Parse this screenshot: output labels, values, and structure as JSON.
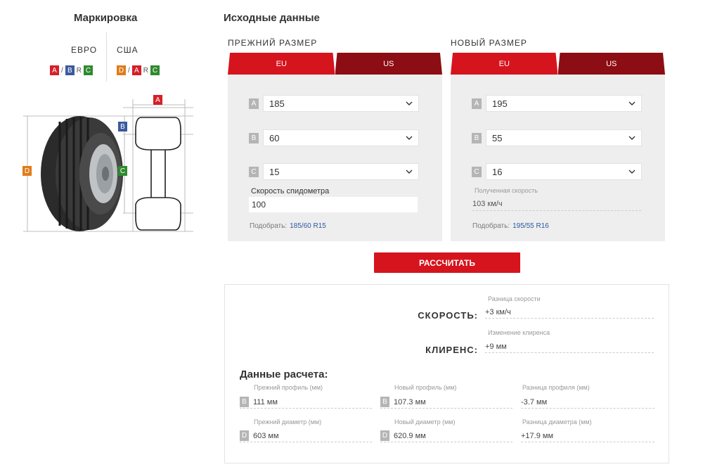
{
  "marking": {
    "title": "Маркировка",
    "euro_label": "ЕВРО",
    "usa_label": "США",
    "euro_badges": [
      "A",
      "/",
      "B",
      "R",
      "C"
    ],
    "usa_badges": [
      "D",
      "/",
      "A",
      "R",
      "C"
    ],
    "diagram_letters": {
      "a": "A",
      "b": "B",
      "c": "C",
      "d": "D"
    }
  },
  "source": {
    "title": "Исходные данные",
    "old": {
      "label": "ПРЕЖНИЙ РАЗМЕР",
      "tab_eu": "EU",
      "tab_us": "US",
      "fields": [
        {
          "letter": "A",
          "value": "185"
        },
        {
          "letter": "B",
          "value": "60"
        },
        {
          "letter": "C",
          "value": "15"
        }
      ],
      "speedo_label": "Скорость спидометра",
      "speedo_value": "100",
      "pick_label": "Подобрать:",
      "pick_link": "185/60 R15"
    },
    "new": {
      "label": "НОВЫЙ РАЗМЕР",
      "tab_eu": "EU",
      "tab_us": "US",
      "fields": [
        {
          "letter": "A",
          "value": "195"
        },
        {
          "letter": "B",
          "value": "55"
        },
        {
          "letter": "C",
          "value": "16"
        }
      ],
      "speed_label": "Полученная скорость",
      "speed_value": "103 км/ч",
      "pick_label": "Подобрать:",
      "pick_link": "195/55 R16"
    },
    "calc_button": "РАССЧИТАТЬ"
  },
  "results": {
    "speed_caption": "Разница скорости",
    "speed_key": "СКОРОСТЬ:",
    "speed_value": "+3 км/ч",
    "clearance_caption": "Изменение клиренса",
    "clearance_key": "КЛИРЕНС:",
    "clearance_value": "+9 мм",
    "calc_title": "Данные расчета:",
    "rows": [
      {
        "cells": [
          {
            "caption": "Прежний профиль (мм)",
            "letter": "B",
            "value": "111 мм"
          },
          {
            "caption": "Новый профиль (мм)",
            "letter": "B",
            "value": "107.3 мм"
          },
          {
            "caption": "Разница профиля (мм)",
            "letter": "",
            "value": "-3.7 мм"
          }
        ]
      },
      {
        "cells": [
          {
            "caption": "Прежний диаметр (мм)",
            "letter": "D",
            "value": "603 мм"
          },
          {
            "caption": "Новый диаметр (мм)",
            "letter": "D",
            "value": "620.9 мм"
          },
          {
            "caption": "Разница диаметра (мм)",
            "letter": "",
            "value": "+17.9 мм"
          }
        ]
      }
    ]
  },
  "colors": {
    "accent_red": "#d6141d",
    "dark_red": "#8c0d13",
    "badge_red": "#d61f26",
    "badge_blue": "#3a5a9e",
    "badge_green": "#2f8a2f",
    "badge_orange": "#e07b1a",
    "link_blue": "#2b5aa0"
  }
}
